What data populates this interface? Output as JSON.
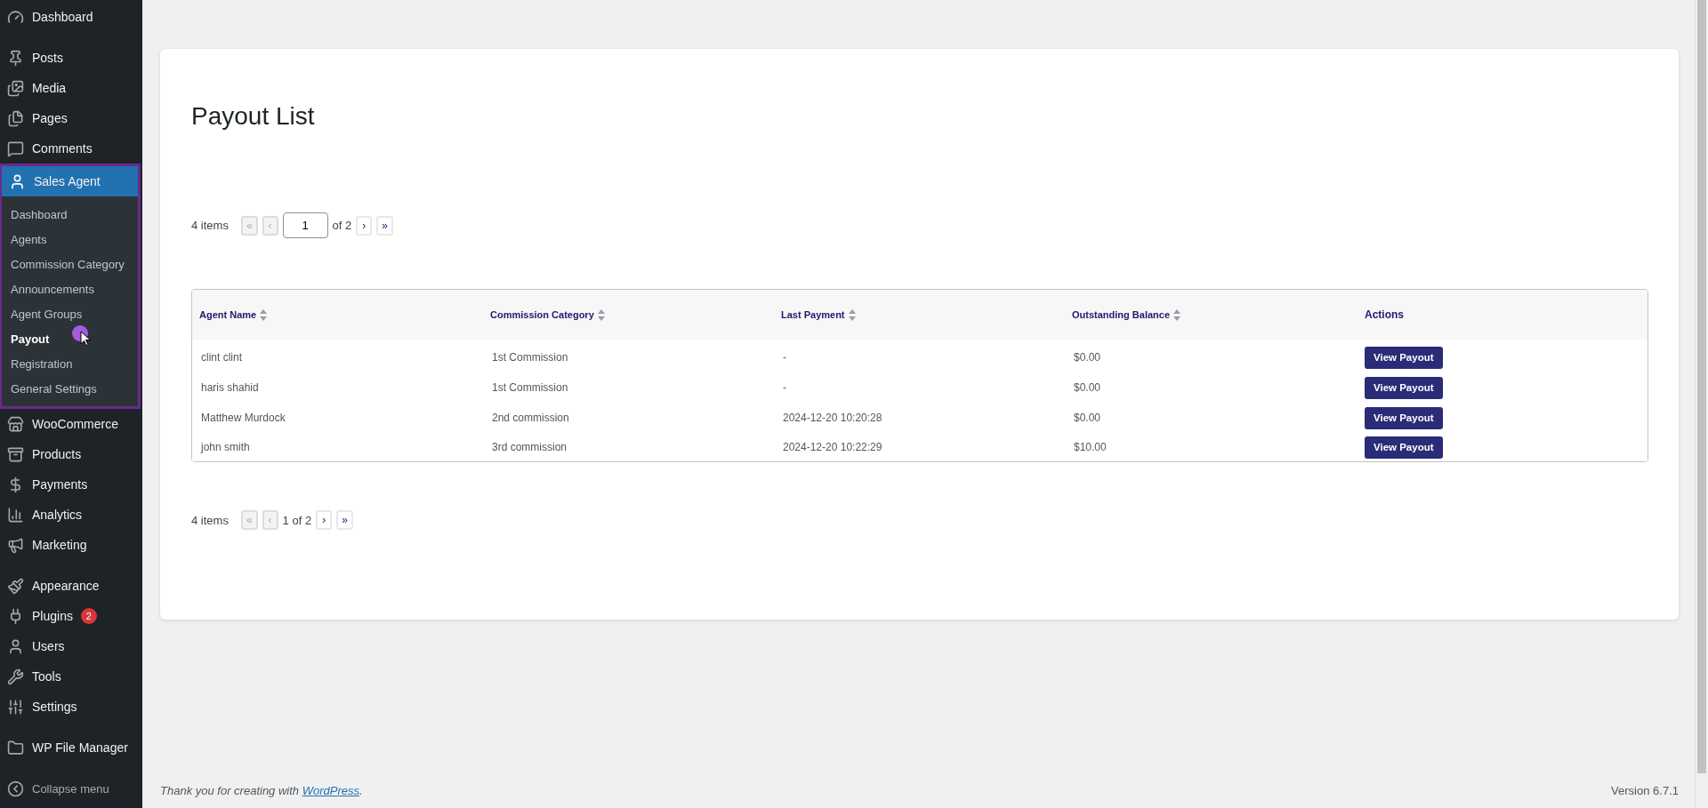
{
  "sidebar": {
    "groups": [
      {
        "items": [
          {
            "label": "Dashboard",
            "selected": false
          }
        ]
      },
      {
        "items": [
          {
            "label": "Posts",
            "selected": false
          },
          {
            "label": "Media",
            "selected": false
          },
          {
            "label": "Pages",
            "selected": false
          },
          {
            "label": "Comments",
            "selected": false
          },
          {
            "label": "Sales Agent",
            "selected": true,
            "expanded": true,
            "children": [
              {
                "label": "Dashboard",
                "selected": false
              },
              {
                "label": "Agents",
                "selected": false
              },
              {
                "label": "Commission Category",
                "selected": false
              },
              {
                "label": "Announcements",
                "selected": false
              },
              {
                "label": "Agent Groups",
                "selected": false
              },
              {
                "label": "Payout",
                "selected": true
              },
              {
                "label": "Registration",
                "selected": false
              },
              {
                "label": "General Settings",
                "selected": false
              }
            ]
          },
          {
            "label": "WooCommerce",
            "selected": false
          },
          {
            "label": "Products",
            "selected": false
          },
          {
            "label": "Payments",
            "selected": false
          },
          {
            "label": "Analytics",
            "selected": false
          },
          {
            "label": "Marketing",
            "selected": false
          }
        ]
      },
      {
        "items": [
          {
            "label": "Appearance",
            "selected": false
          },
          {
            "label": "Plugins",
            "selected": false,
            "badge": "2"
          },
          {
            "label": "Users",
            "selected": false
          },
          {
            "label": "Tools",
            "selected": false
          },
          {
            "label": "Settings",
            "selected": false
          }
        ]
      },
      {
        "items": [
          {
            "label": "WP File Manager",
            "selected": false
          }
        ]
      }
    ],
    "collapse": "Collapse menu"
  },
  "page": {
    "title": "Payout List",
    "top_pager": {
      "count": "4 items",
      "first": {
        "label": "«",
        "disabled": true
      },
      "prev": {
        "label": "‹",
        "disabled": true
      },
      "page_value": "1",
      "of": "of 2",
      "next": {
        "label": "›",
        "disabled": false
      },
      "last": {
        "label": "»",
        "disabled": false
      }
    },
    "table": {
      "columns": [
        {
          "label": "Agent Name",
          "sortable": true
        },
        {
          "label": "Commission Category",
          "sortable": true
        },
        {
          "label": "Last Payment",
          "sortable": true
        },
        {
          "label": "Outstanding Balance",
          "sortable": true
        },
        {
          "label": "Actions",
          "sortable": false
        }
      ],
      "rows": [
        {
          "cells": [
            "clint clint",
            "1st Commission",
            "-",
            "$0.00"
          ],
          "action": "View Payout"
        },
        {
          "cells": [
            "haris shahid",
            "1st Commission",
            "-",
            "$0.00"
          ],
          "action": "View Payout"
        },
        {
          "cells": [
            "Matthew Murdock",
            "2nd commission",
            "2024-12-20 10:20:28",
            "$0.00"
          ],
          "action": "View Payout"
        },
        {
          "cells": [
            "john smith",
            "3rd commission",
            "2024-12-20 10:22:29",
            "$10.00"
          ],
          "action": "View Payout"
        }
      ]
    },
    "bottom_pager": {
      "count": "4 items",
      "first": {
        "label": "«",
        "disabled": true
      },
      "prev": {
        "label": "‹",
        "disabled": true
      },
      "page_text": "1 of 2",
      "next": {
        "label": "›",
        "disabled": false
      },
      "last": {
        "label": "»",
        "disabled": false
      }
    }
  },
  "footer": {
    "text_before": "Thank you for creating with ",
    "link": "WordPress",
    "text_after": ".",
    "version": "Version 6.7.1"
  }
}
